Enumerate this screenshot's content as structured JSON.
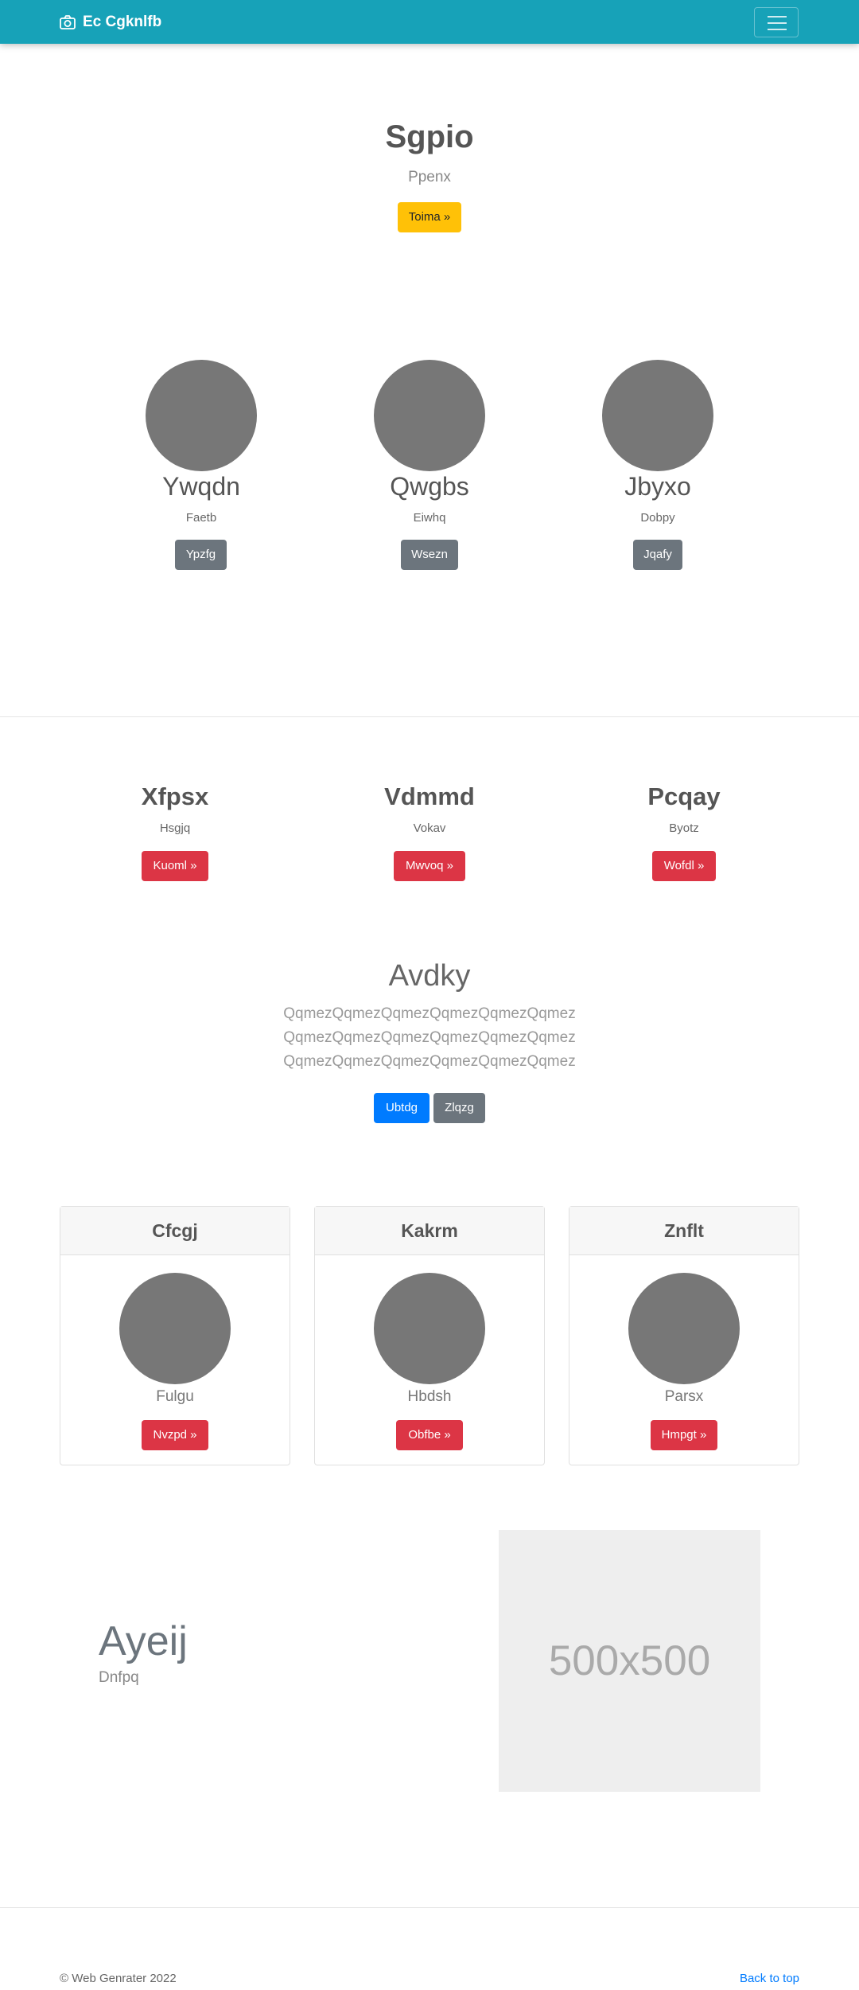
{
  "navbar": {
    "brand": "Ec Cgknlfb",
    "bg_color": "#17a2b8",
    "icons": [
      "camera-icon",
      "hamburger-icon"
    ]
  },
  "hero": {
    "title": "Sgpio",
    "subtitle": "Ppenx",
    "button": "Toima »"
  },
  "profiles": [
    {
      "name": "Ywqdn",
      "text": "Faetb",
      "button": "Ypzfg"
    },
    {
      "name": "Qwgbs",
      "text": "Eiwhq",
      "button": "Wsezn"
    },
    {
      "name": "Jbyxo",
      "text": "Dobpy",
      "button": "Jqafy"
    }
  ],
  "features": [
    {
      "title": "Xfpsx",
      "text": "Hsgjq",
      "button": "Kuoml »"
    },
    {
      "title": "Vdmmd",
      "text": "Vokav",
      "button": "Mwvoq »"
    },
    {
      "title": "Pcqay",
      "text": "Byotz",
      "button": "Wofdl »"
    }
  ],
  "jumbo": {
    "title": "Avdky",
    "lines": [
      "QqmezQqmezQqmezQqmezQqmezQqmez",
      "QqmezQqmezQqmezQqmezQqmezQqmez",
      "QqmezQqmezQqmezQqmezQqmezQqmez"
    ],
    "primary_button": "Ubtdg",
    "secondary_button": "Zlqzg"
  },
  "cards": [
    {
      "header": "Cfcgj",
      "text": "Fulgu",
      "button": "Nvzpd »"
    },
    {
      "header": "Kakrm",
      "text": "Hbdsh",
      "button": "Obfbe »"
    },
    {
      "header": "Znflt",
      "text": "Parsx",
      "button": "Hmpgt »"
    }
  ],
  "split": {
    "title": "Ayeij",
    "subtitle": "Dnfpq",
    "placeholder": "500x500"
  },
  "footer": {
    "copyright": "© Web Genrater 2022",
    "back_to_top": "Back to top"
  }
}
